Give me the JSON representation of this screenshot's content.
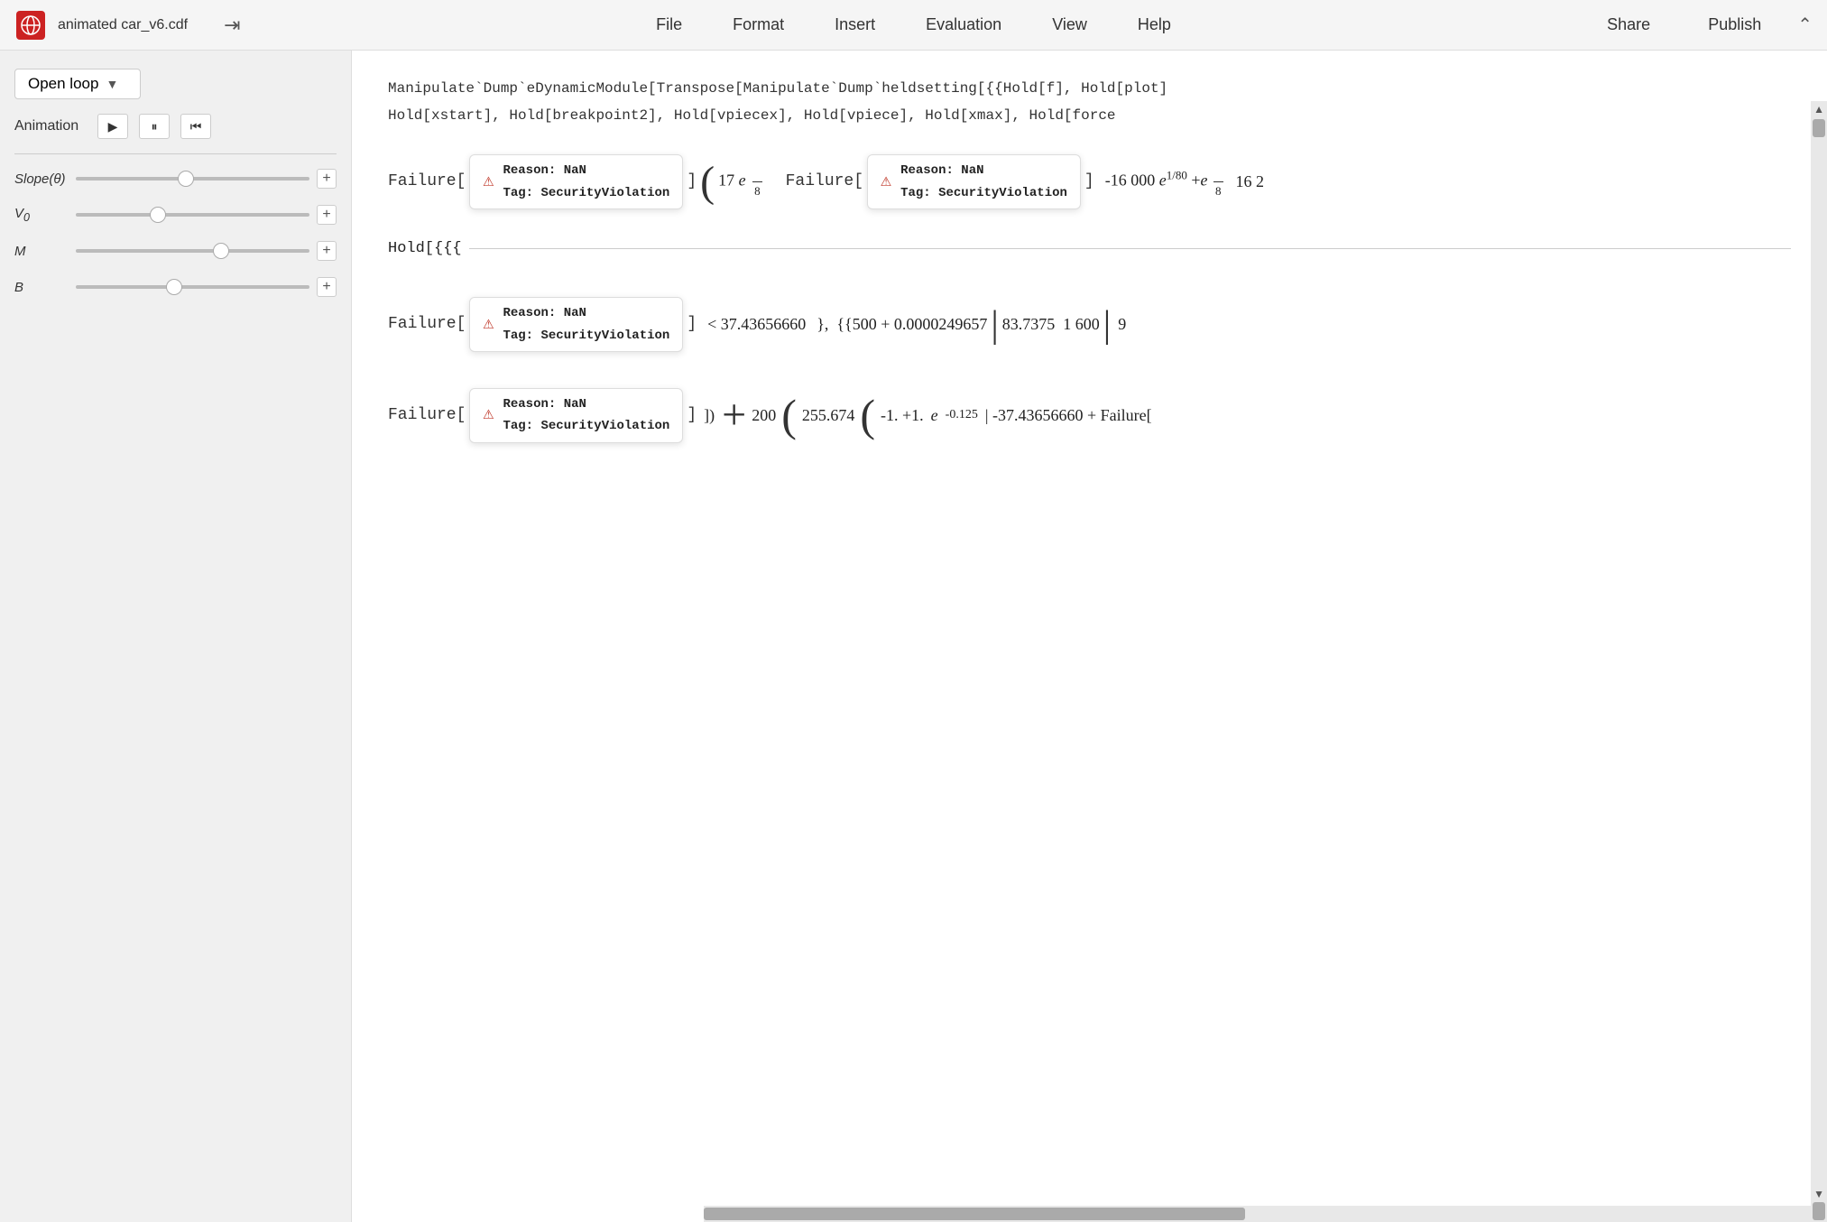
{
  "window": {
    "title": "animated car_v6.cdf"
  },
  "menubar": {
    "logo_alt": "Wolfram logo",
    "title": "animated car_v6.cdf",
    "nav_items": [
      "File",
      "Format",
      "Insert",
      "Evaluation",
      "View",
      "Help"
    ],
    "share_label": "Share",
    "publish_label": "Publish"
  },
  "sidebar": {
    "open_loop_label": "Open loop",
    "animation_label": "Animation",
    "play_label": "▶",
    "pause_label": "⏸",
    "reset_label": "⏮",
    "sliders": [
      {
        "label": "Slope(θ)",
        "position": 0.47,
        "plus": "+"
      },
      {
        "label": "V₀",
        "position": 0.35,
        "plus": "+"
      },
      {
        "label": "M",
        "position": 0.62,
        "plus": "+"
      },
      {
        "label": "B",
        "position": 0.42,
        "plus": "+"
      }
    ]
  },
  "content": {
    "code_line1": "Manipulate`Dump`eDynamicModule[Transpose[Manipulate`Dump`heldsetting[{{Hold[f], Hold[plot]",
    "code_line2": "Hold[xstart], Hold[breakpoint2], Hold[vpiecex], Hold[vpiece], Hold[xmax], Hold[force",
    "failure_blocks": [
      {
        "id": "failure1",
        "prefix": "Failure[",
        "reason": "NaN",
        "tag": "SecurityViolation"
      },
      {
        "id": "failure2",
        "prefix": "Failure[",
        "reason": "NaN",
        "tag": "SecurityViolation"
      },
      {
        "id": "failure3",
        "prefix": "Failure[",
        "reason": "NaN",
        "tag": "SecurityViolation"
      },
      {
        "id": "failure4",
        "prefix": "Failure[",
        "reason": "NaN",
        "tag": "SecurityViolation"
      }
    ],
    "math_line1": "Hold[{{{",
    "math_expr1": "17 e",
    "math_exp1_super": "8",
    "math_expr2": "-16 000 e",
    "math_exp2_super": "1/80",
    "math_expr3": "+e",
    "math_expr3b": "8",
    "math_expr4": "16 2",
    "comparison": "< 37.43656660",
    "matrix_data": "{{500+0.0000249657",
    "matrix_cols": "83.7375  1 600  9",
    "exponent_line": "-0.125",
    "expr_bottom1": "-37.43656660+Failure[",
    "expr_bottom2": "] + 200",
    "expr_bottom3": "255.674",
    "expr_bottom4": "-1. +1.",
    "expr_bottom5": "e",
    "reason_label": "Reason:",
    "tag_label": "Tag:"
  }
}
